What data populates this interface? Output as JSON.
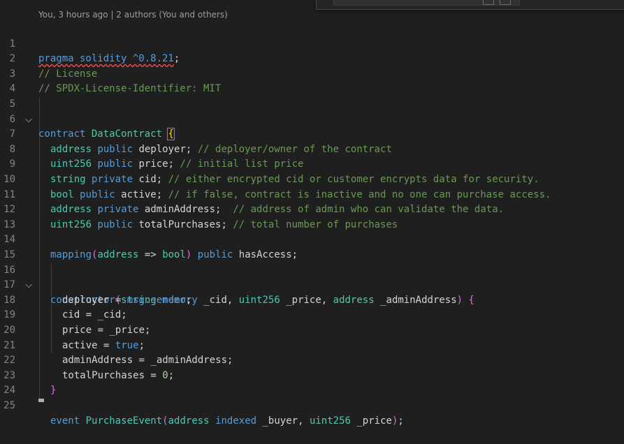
{
  "blame_annotation": "You, 3 hours ago | 2 authors (You and others)",
  "colors": {
    "background": "#1f1f1f",
    "keyword": "#569cd6",
    "type": "#4ec9b0",
    "comment": "#6a9955",
    "number": "#b5cea8",
    "function": "#dcdcaa",
    "variable": "#9cdcfe",
    "line_number": "#858585",
    "error_squiggle": "#f14c4c",
    "bracket_gold": "#ffd700",
    "bracket_purple": "#da70d6",
    "bracket_blue": "#179fff"
  },
  "gutter": {
    "line_numbers": [
      "1",
      "2",
      "3",
      "4",
      "5",
      "6",
      "7",
      "8",
      "9",
      "10",
      "11",
      "12",
      "13",
      "14",
      "15",
      "16",
      "17",
      "18",
      "19",
      "20",
      "21",
      "22",
      "23",
      "24",
      "25"
    ],
    "fold_icons": [
      "chevron-down-icon",
      "chevron-down-icon"
    ]
  },
  "code": {
    "l1": {
      "t1": "pragma solidity ^0.8.21",
      "t2": ";"
    },
    "l2": {
      "t1": "// License"
    },
    "l3": {
      "t1": "// SPDX-License-Identifier: MIT"
    },
    "l5": {
      "t1": "contract",
      "t2": " ",
      "t3": "DataContract",
      "t4": " ",
      "t5": "{"
    },
    "l7": {
      "t1": "address",
      "t2": " ",
      "t3": "public",
      "t4": " deployer; ",
      "t5": "// deployer/owner of the contract"
    },
    "l8": {
      "t1": "uint256",
      "t2": " ",
      "t3": "public",
      "t4": " price; ",
      "t5": "// initial list price"
    },
    "l9": {
      "t1": "string",
      "t2": " ",
      "t3": "private",
      "t4": " cid; ",
      "t5": "// either encrypted cid or customer encrypts data for security."
    },
    "l10": {
      "t1": "bool",
      "t2": " ",
      "t3": "public",
      "t4": " active; ",
      "t5": "// if false, contract is inactive and no one can purchase access."
    },
    "l11": {
      "t1": "address",
      "t2": " ",
      "t3": "private",
      "t4": " adminAddress;  ",
      "t5": "// address of admin who can validate the data."
    },
    "l12": {
      "t1": "uint256",
      "t2": " ",
      "t3": "public",
      "t4": " totalPurchases; ",
      "t5": "// total number of purchases"
    },
    "l14": {
      "t1": "mapping",
      "t2": "(",
      "t3": "address",
      "t4": " => ",
      "t5": "bool",
      "t6": ")",
      "t7": " ",
      "t8": "public",
      "t9": " hasAccess;"
    },
    "l16": {
      "t1": "constructor",
      "t2": "(",
      "t3": "string",
      "t4": " ",
      "t5": "memory",
      "t6": " _cid, ",
      "t7": "uint256",
      "t8": " _price, ",
      "t9": "address",
      "t10": " _adminAddress",
      "t11": ")",
      "t12": " ",
      "t13": "{"
    },
    "l17": {
      "t1": "deployer = ",
      "t2": "msg",
      "t3": ".",
      "t4": "sender",
      "t5": ";"
    },
    "l18": {
      "t1": "cid = _cid;"
    },
    "l19": {
      "t1": "price = _price;"
    },
    "l20": {
      "t1": "active = ",
      "t2": "true",
      "t3": ";"
    },
    "l21": {
      "t1": "adminAddress = _adminAddress;"
    },
    "l22": {
      "t1": "totalPurchases = ",
      "t2": "0",
      "t3": ";"
    },
    "l23": {
      "t1": "}"
    },
    "l25": {
      "t1": "event",
      "t2": " ",
      "t3": "PurchaseEvent",
      "t4": "(",
      "t5": "address",
      "t6": " ",
      "t7": "indexed",
      "t8": " _buyer, ",
      "t9": "uint256",
      "t10": " _price",
      "t11": ")",
      "t12": ";"
    }
  }
}
